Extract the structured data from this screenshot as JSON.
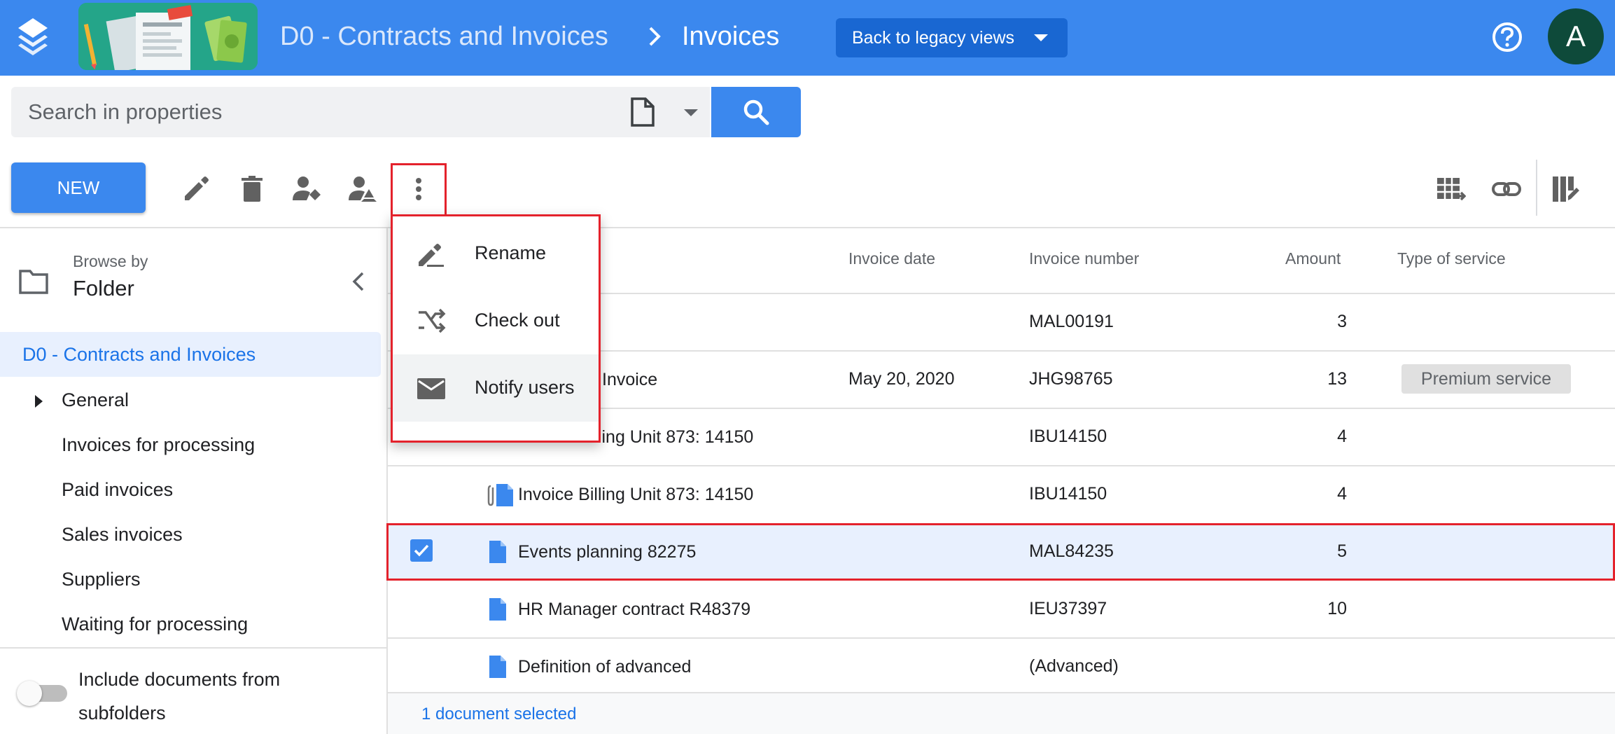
{
  "header": {
    "breadcrumb_root": "D0 - Contracts and Invoices",
    "breadcrumb_current": "Invoices",
    "legacy_button": "Back to legacy views",
    "avatar_initial": "A",
    "brand_color": "#3b88ee"
  },
  "search": {
    "placeholder": "Search in properties"
  },
  "toolbar": {
    "new_label": "NEW",
    "icons": [
      "edit-icon",
      "delete-icon",
      "assign-user-icon",
      "share-drive-icon",
      "more-vert-icon",
      "export-table-icon",
      "link-icon",
      "column-settings-icon"
    ]
  },
  "sidebar": {
    "browse_by": "Browse by",
    "browse_mode": "Folder",
    "items": [
      {
        "label": "D0 - Contracts and Invoices",
        "active": true
      },
      {
        "label": "General",
        "expandable": true
      },
      {
        "label": "Invoices for processing"
      },
      {
        "label": "Paid invoices"
      },
      {
        "label": "Sales invoices"
      },
      {
        "label": "Suppliers"
      },
      {
        "label": "Waiting for processing"
      }
    ],
    "include_subfolders": "Include documents from subfolders",
    "include_subfolders_on": false
  },
  "menu": {
    "items": [
      {
        "label": "Rename",
        "icon": "rename-icon"
      },
      {
        "label": "Check out",
        "icon": "checkout-icon"
      },
      {
        "label": "Notify users",
        "icon": "mail-icon"
      }
    ]
  },
  "table": {
    "columns": [
      "Invoice date",
      "Invoice number",
      "Amount",
      "Type of service"
    ],
    "rows": [
      {
        "name": "",
        "date": "",
        "number": "MAL00191",
        "amount": "3",
        "service": ""
      },
      {
        "name": "Invoice",
        "date": "May 20, 2020",
        "number": "JHG98765",
        "amount": "13",
        "service": "Premium service"
      },
      {
        "name": "Invoice Billing Unit 873: 14150",
        "date": "",
        "number": "IBU14150",
        "amount": "4",
        "service": ""
      },
      {
        "name": "Invoice Billing Unit 873: 14150",
        "date": "",
        "number": "IBU14150",
        "amount": "4",
        "service": ""
      },
      {
        "name": "Events planning 82275",
        "date": "",
        "number": "MAL84235",
        "amount": "5",
        "service": "",
        "selected": true
      },
      {
        "name": "HR Manager contract R48379",
        "date": "",
        "number": "IEU37397",
        "amount": "10",
        "service": ""
      },
      {
        "name": "Definition of advanced",
        "date": "",
        "number": "(Advanced)",
        "amount": "",
        "service": ""
      }
    ]
  },
  "footer": {
    "selection": "1 document selected"
  },
  "colors": {
    "accent": "#3b88ee",
    "highlight_red": "#e4222c",
    "selected_row": "#e8f0fe"
  }
}
